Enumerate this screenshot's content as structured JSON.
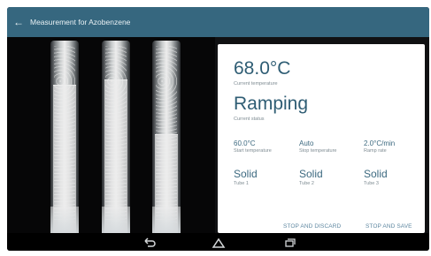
{
  "appbar": {
    "back_icon": "arrow-left-icon",
    "title": "Measurement for Azobenzene"
  },
  "camera": {
    "tubes": [
      {
        "name": "Tube 1"
      },
      {
        "name": "Tube 2"
      },
      {
        "name": "Tube 3"
      }
    ]
  },
  "measurement": {
    "current_temperature": "68.0°C",
    "current_temperature_label": "Current temperature",
    "current_status": "Ramping",
    "current_status_label": "Current status",
    "start_temperature": "60.0°C",
    "start_temperature_label": "Start temperature",
    "stop_temperature": "Auto",
    "stop_temperature_label": "Stop temperature",
    "ramp_rate": "2.0°C/min",
    "ramp_rate_label": "Ramp rate",
    "tubes": [
      {
        "state": "Solid",
        "label": "Tube 1"
      },
      {
        "state": "Solid",
        "label": "Tube 2"
      },
      {
        "state": "Solid",
        "label": "Tube 3"
      }
    ],
    "stop_discard_label": "STOP AND DISCARD",
    "stop_save_label": "STOP AND SAVE"
  },
  "navbar": {
    "back_icon": "back-icon",
    "home_icon": "home-icon",
    "recents_icon": "recent-apps-icon"
  },
  "colors": {
    "appbar": "#36677f",
    "accent_text": "#2f5d74",
    "secondary_text": "#7f8c93",
    "button_text": "#5e87a0",
    "device_bezel": "#101113"
  }
}
